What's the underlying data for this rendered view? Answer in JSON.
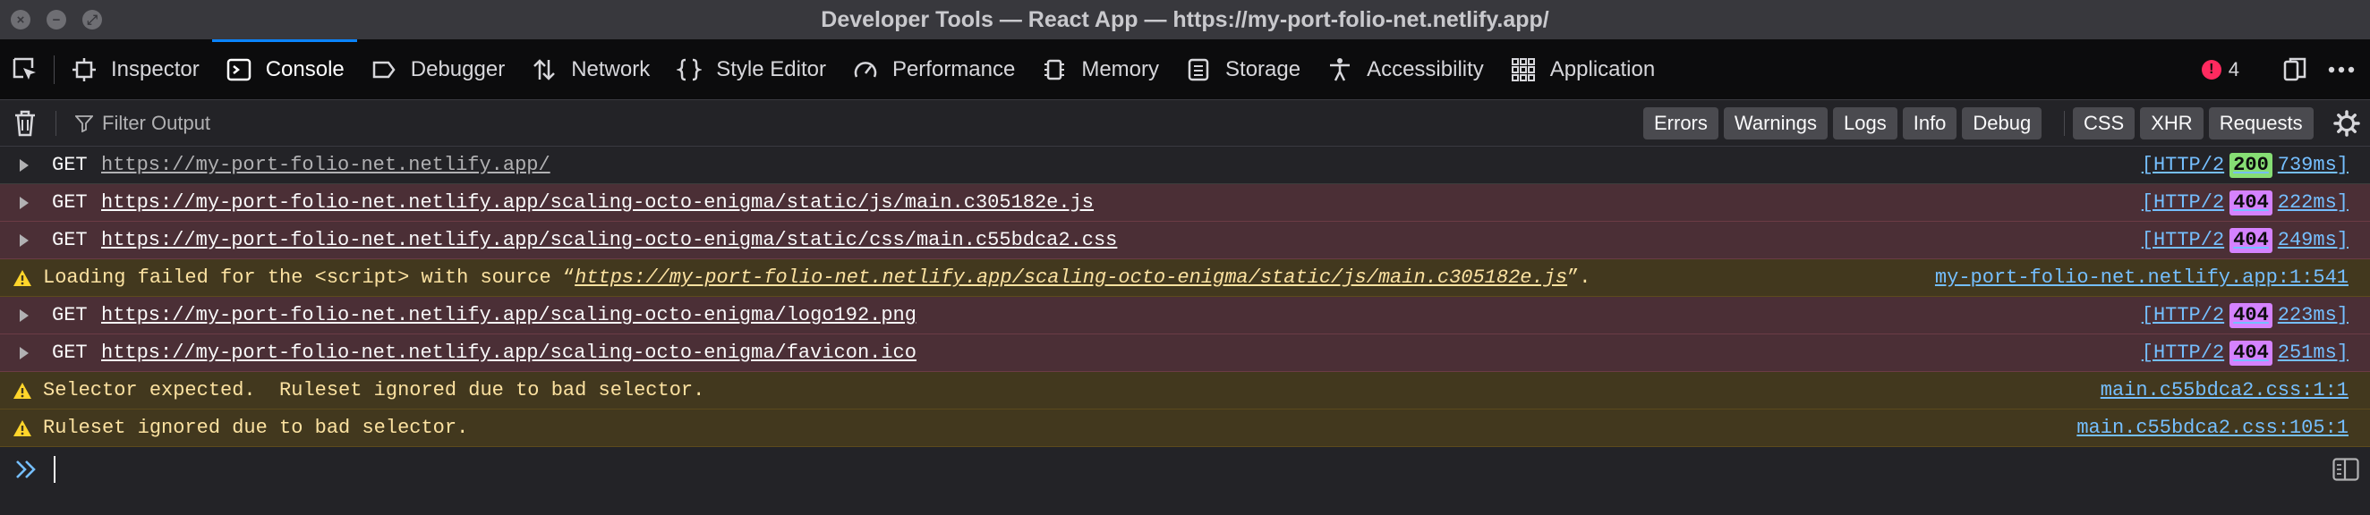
{
  "window": {
    "title": "Developer Tools — React App — https://my-port-folio-net.netlify.app/",
    "close_glyph": "×",
    "minimize_glyph": "−",
    "zoom_glyph": "⤢"
  },
  "toolbox": {
    "picker_icon": "element-picker-icon",
    "tabs": [
      {
        "id": "inspector",
        "label": "Inspector",
        "icon": "inspector-icon"
      },
      {
        "id": "console",
        "label": "Console",
        "icon": "console-icon",
        "selected": true
      },
      {
        "id": "debugger",
        "label": "Debugger",
        "icon": "debugger-icon"
      },
      {
        "id": "network",
        "label": "Network",
        "icon": "network-icon"
      },
      {
        "id": "style-editor",
        "label": "Style Editor",
        "icon": "style-editor-icon"
      },
      {
        "id": "performance",
        "label": "Performance",
        "icon": "performance-icon"
      },
      {
        "id": "memory",
        "label": "Memory",
        "icon": "memory-icon"
      },
      {
        "id": "storage",
        "label": "Storage",
        "icon": "storage-icon"
      },
      {
        "id": "accessibility",
        "label": "Accessibility",
        "icon": "accessibility-icon"
      },
      {
        "id": "application",
        "label": "Application",
        "icon": "application-icon"
      }
    ],
    "error_count": "4",
    "error_dot_glyph": "!"
  },
  "filter": {
    "placeholder": "Filter Output",
    "buttons": [
      "Errors",
      "Warnings",
      "Logs",
      "Info",
      "Debug"
    ],
    "net_buttons": [
      "CSS",
      "XHR",
      "Requests"
    ]
  },
  "messages": [
    {
      "kind": "ok",
      "method": "GET",
      "url": "https://my-port-folio-net.netlify.app/",
      "proto": "[HTTP/2",
      "status": "200",
      "time": "739ms]"
    },
    {
      "kind": "err",
      "method": "GET",
      "url": "https://my-port-folio-net.netlify.app/scaling-octo-enigma/static/js/main.c305182e.js",
      "proto": "[HTTP/2",
      "status": "404",
      "time": "222ms]"
    },
    {
      "kind": "err",
      "method": "GET",
      "url": "https://my-port-folio-net.netlify.app/scaling-octo-enigma/static/css/main.c55bdca2.css",
      "proto": "[HTTP/2",
      "status": "404",
      "time": "249ms]"
    },
    {
      "kind": "warn",
      "text_before": "Loading failed for the <script> with source “",
      "link": "https://my-port-folio-net.netlify.app/scaling-octo-enigma/static/js/main.c305182e.js",
      "text_after": "”.",
      "source": "my-port-folio-net.netlify.app:1:541"
    },
    {
      "kind": "err",
      "method": "GET",
      "url": "https://my-port-folio-net.netlify.app/scaling-octo-enigma/logo192.png",
      "proto": "[HTTP/2",
      "status": "404",
      "time": "223ms]"
    },
    {
      "kind": "err",
      "method": "GET",
      "url": "https://my-port-folio-net.netlify.app/scaling-octo-enigma/favicon.ico",
      "proto": "[HTTP/2",
      "status": "404",
      "time": "251ms]"
    },
    {
      "kind": "warn",
      "text_before": "Selector expected.  Ruleset ignored due to bad selector.",
      "link": "",
      "text_after": "",
      "source": "main.c55bdca2.css:1:1"
    },
    {
      "kind": "warn",
      "text_before": "Ruleset ignored due to bad selector.",
      "link": "",
      "text_after": "",
      "source": "main.c55bdca2.css:105:1"
    }
  ],
  "colors": {
    "accent": "#0a84ff",
    "status_200": "#86de74",
    "status_404": "#d582ff",
    "warning_bg": "#42381e",
    "error_bg": "#4b2f36"
  }
}
